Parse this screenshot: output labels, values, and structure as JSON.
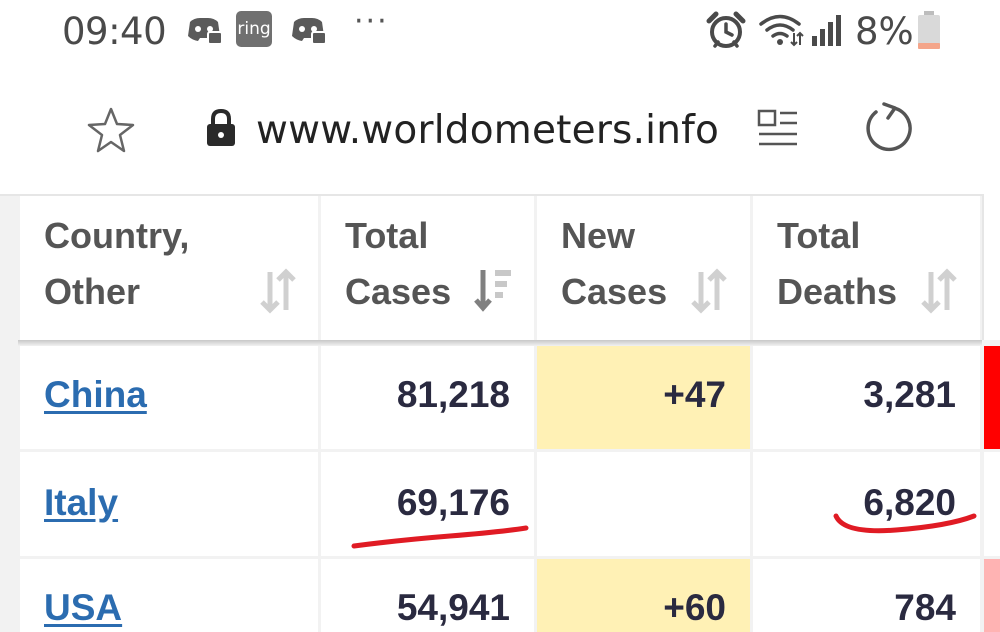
{
  "status_bar": {
    "time": "09:40",
    "notification_icons": [
      "discord-icon",
      "ring-icon",
      "discord-icon"
    ],
    "ring_label": "ring",
    "more_indicator": "···",
    "system_icons": [
      "alarm-icon",
      "wifi-icon",
      "signal-icon",
      "battery-icon"
    ],
    "battery_percent": "8%",
    "battery_level": 0.08,
    "battery_color": "#f4a58a"
  },
  "browser": {
    "url": "www.worldometers.info",
    "icons": [
      "star-icon",
      "lock-icon",
      "reader-mode-icon",
      "reload-icon"
    ]
  },
  "table": {
    "headers": [
      {
        "line1": "Country,",
        "line2": "Other"
      },
      {
        "line1": "Total",
        "line2": "Cases"
      },
      {
        "line1": "New",
        "line2": "Cases"
      },
      {
        "line1": "Total",
        "line2": "Deaths"
      }
    ],
    "rows": [
      {
        "country": "China",
        "total_cases": "81,218",
        "new_cases": "+47",
        "total_deaths": "3,281"
      },
      {
        "country": "Italy",
        "total_cases": "69,176",
        "new_cases": "",
        "total_deaths": "6,820"
      },
      {
        "country": "USA",
        "total_cases": "54,941",
        "new_cases": "+60",
        "total_deaths": "784"
      }
    ],
    "annotations": "red hand-drawn underline under Italy total cases and total deaths",
    "colors": {
      "link": "#2b6cb0",
      "new_cases_highlight": "#fff1b5",
      "header_text": "#555555",
      "number_text": "#2a2a40",
      "annotation": "#e01b24",
      "side_strip": "#ff0000"
    }
  }
}
